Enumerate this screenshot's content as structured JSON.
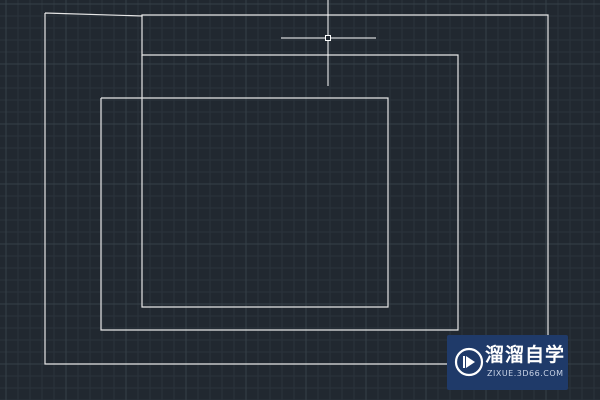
{
  "app": {
    "name": "CAD drawing workspace"
  },
  "colors": {
    "background": "#212830",
    "grid_minor": "#2b333c",
    "grid_major": "#354048",
    "stroke": "#e6e6e6",
    "crosshair": "#ffffff",
    "watermark_bg": "#1f3a69"
  },
  "canvas": {
    "drawn_objects": [
      {
        "kind": "polyline",
        "label": "outer-frame"
      },
      {
        "kind": "polyline",
        "label": "middle-frame"
      },
      {
        "kind": "rectangle",
        "label": "inner-rectangle"
      }
    ],
    "cursor": {
      "kind": "crosshair",
      "icon": "crosshair-cursor-icon"
    }
  },
  "watermark": {
    "icon": "play-logo-icon",
    "title": "溜溜自学",
    "url": "ZIXUE.3D66.COM"
  }
}
